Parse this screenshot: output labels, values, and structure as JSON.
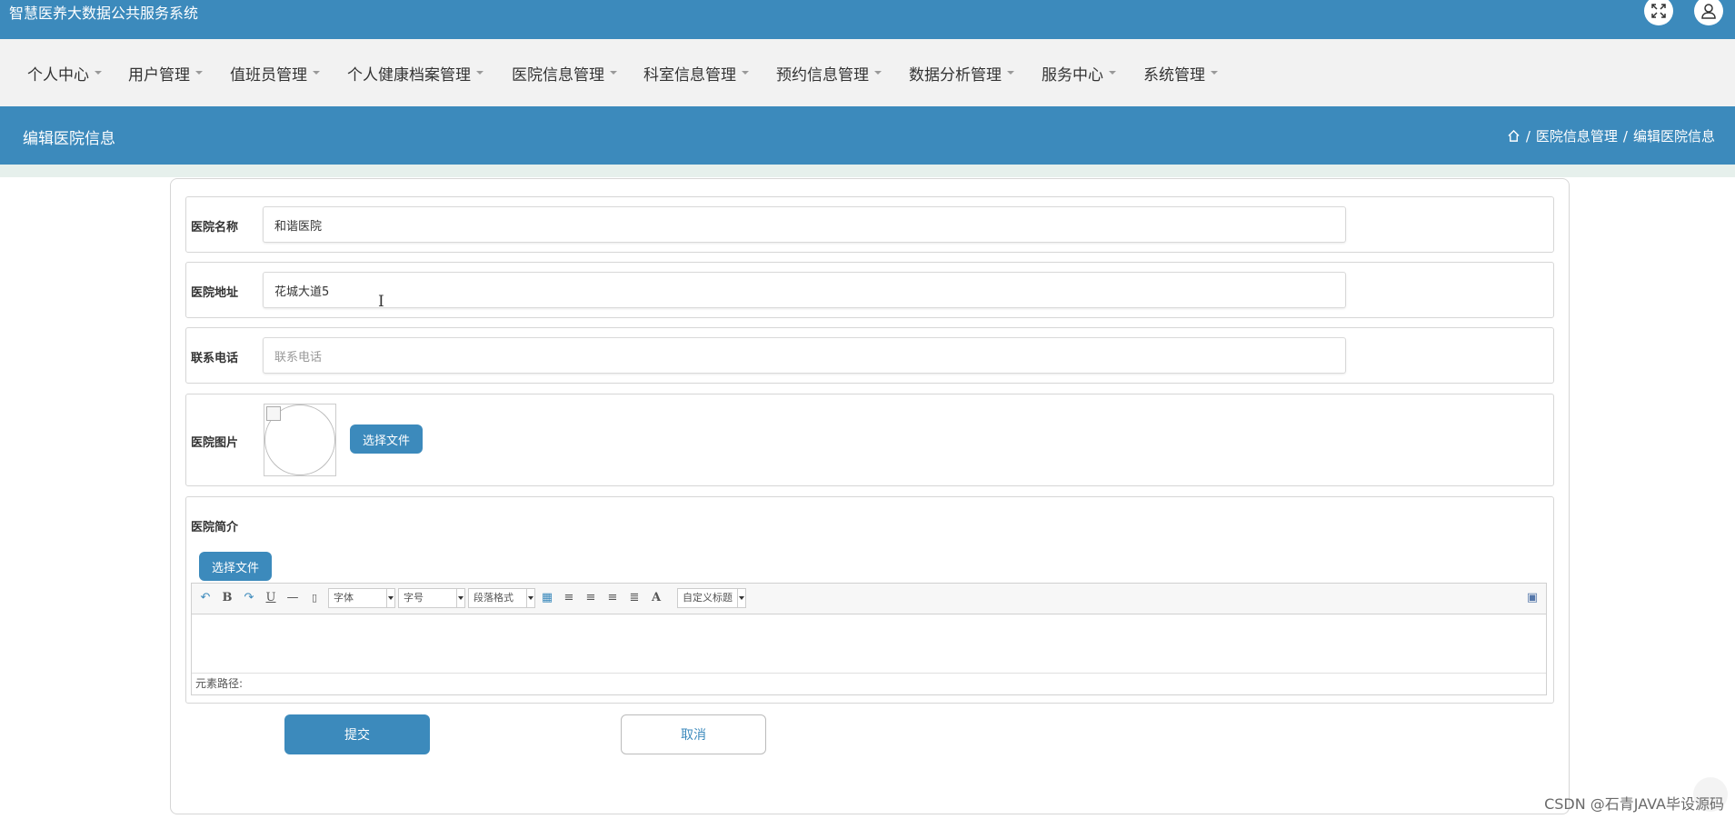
{
  "app": {
    "title": "智慧医养大数据公共服务系统"
  },
  "top_icons": [
    "fullscreen-icon",
    "user-icon"
  ],
  "menu": [
    {
      "label": "个人中心"
    },
    {
      "label": "用户管理"
    },
    {
      "label": "值班员管理"
    },
    {
      "label": "个人健康档案管理"
    },
    {
      "label": "医院信息管理"
    },
    {
      "label": "科室信息管理"
    },
    {
      "label": "预约信息管理"
    },
    {
      "label": "数据分析管理"
    },
    {
      "label": "服务中心"
    },
    {
      "label": "系统管理"
    }
  ],
  "page": {
    "title": "编辑医院信息",
    "breadcrumb": [
      "医院信息管理",
      "编辑医院信息"
    ]
  },
  "form": {
    "name": {
      "label": "医院名称",
      "value": "和谐医院"
    },
    "address": {
      "label": "医院地址",
      "value": "花城大道5"
    },
    "phone": {
      "label": "联系电话",
      "placeholder": "联系电话",
      "value": ""
    },
    "image": {
      "label": "医院图片",
      "upload_label": "选择文件"
    },
    "intro": {
      "label": "医院简介",
      "upload_label": "选择文件",
      "toolbar": {
        "font": "字体",
        "size": "字号",
        "paragraph": "段落格式",
        "custom_title": "自定义标题",
        "bold": "B",
        "underline": "U",
        "font_color": "A"
      },
      "element_path": "元素路径:"
    },
    "submit_label": "提交",
    "cancel_label": "取消"
  },
  "watermark": "CSDN @石青JAVA毕设源码",
  "colors": {
    "primary": "#3c8abc",
    "menubar": "#f2f2f2"
  }
}
